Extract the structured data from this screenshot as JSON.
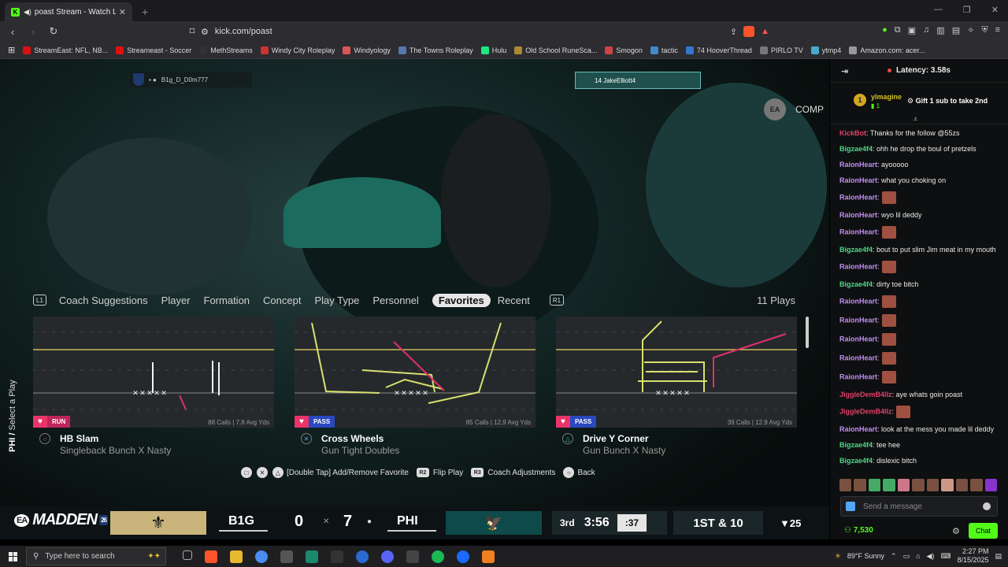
{
  "browser": {
    "tab_title": "poast Stream - Watch Live on",
    "url": "kick.com/poast",
    "bookmarks": [
      {
        "label": "StreamEast: NFL, NB...",
        "color": "#d11"
      },
      {
        "label": "Streameast - Soccer",
        "color": "#d11"
      },
      {
        "label": "MethStreams",
        "color": "#333"
      },
      {
        "label": "Windy City Roleplay",
        "color": "#c33"
      },
      {
        "label": "Windyology",
        "color": "#d55"
      },
      {
        "label": "The Towns Roleplay",
        "color": "#57a"
      },
      {
        "label": "Hulu",
        "color": "#1ce783"
      },
      {
        "label": "Old School RuneSca...",
        "color": "#a83"
      },
      {
        "label": "Smogon",
        "color": "#c44"
      },
      {
        "label": "tactic",
        "color": "#48c"
      },
      {
        "label": "74 HooverThread",
        "color": "#37c"
      },
      {
        "label": "PIRLO TV",
        "color": "#777"
      },
      {
        "label": "ytmp4",
        "color": "#4ac"
      },
      {
        "label": "Amazon.com: acer...",
        "color": "#999"
      }
    ]
  },
  "game": {
    "gamertag": "B1g_D_D0m777",
    "comp_label": "COMP",
    "ea_label": "EA",
    "overlay_tag": "14 JakeElliott4",
    "side_label_team": "PHI /",
    "side_label_rest": "Select a Play",
    "filters": {
      "l1": "L1",
      "r1": "R1",
      "tabs": [
        "Coach Suggestions",
        "Player",
        "Formation",
        "Concept",
        "Play Type",
        "Personnel",
        "Favorites",
        "Recent"
      ],
      "active": "Favorites",
      "count": "11 Plays"
    },
    "plays": [
      {
        "type": "RUN",
        "calls": "88 Calls | 7.8 Avg Yds",
        "name": "HB Slam",
        "formation": "Singleback Bunch X Nasty",
        "button": "○"
      },
      {
        "type": "PASS",
        "calls": "85 Calls | 12.9 Avg Yds",
        "name": "Cross Wheels",
        "formation": "Gun Tight Doubles",
        "button": "✕"
      },
      {
        "type": "PASS",
        "calls": "39 Calls | 12.9 Avg Yds",
        "name": "Drive Y Corner",
        "formation": "Gun Bunch X Nasty",
        "button": "△"
      }
    ],
    "actions": {
      "favorite": "[Double Tap] Add/Remove Favorite",
      "r2": "R2",
      "flip": "Flip Play",
      "r3": "R3",
      "adjust": "Coach Adjustments",
      "back": "Back"
    },
    "scorebug": {
      "logo": "MADDEN",
      "logo_num": "26",
      "away_team": "B1G",
      "away_score": "0",
      "home_score": "7",
      "home_team": "PHI",
      "quarter": "3rd",
      "clock": "3:56",
      "play_clock": ":37",
      "down": "1ST & 10",
      "to_go": "▼25"
    }
  },
  "chat": {
    "latency": "Latency: 3.58s",
    "pinned": {
      "rank": "1",
      "user": "ylmagine",
      "count": "1",
      "gift": "Gift 1 sub to take 2nd"
    },
    "messages": [
      {
        "user": "KickBot",
        "color": "#e0406a",
        "text": ": Thanks for the follow @55zs",
        "emote": false
      },
      {
        "user": "Bigzae4f4",
        "color": "#4fd88a",
        "text": ": ohh he drop the boul of pretzels",
        "emote": false
      },
      {
        "user": "RaionHeart",
        "color": "#c090f0",
        "text": ": ayooooo",
        "emote": false
      },
      {
        "user": "RaionHeart",
        "color": "#c090f0",
        "text": ": what you choking on",
        "emote": false
      },
      {
        "user": "RaionHeart",
        "color": "#c090f0",
        "text": ":",
        "emote": true
      },
      {
        "user": "RaionHeart",
        "color": "#c090f0",
        "text": ": wyo lil deddy",
        "emote": false
      },
      {
        "user": "RaionHeart",
        "color": "#c090f0",
        "text": ":",
        "emote": true
      },
      {
        "user": "Bigzae4f4",
        "color": "#4fd88a",
        "text": ": bout to put slim Jim meat in my mouth",
        "emote": false
      },
      {
        "user": "RaionHeart",
        "color": "#c090f0",
        "text": ":",
        "emote": true
      },
      {
        "user": "Bigzae4f4",
        "color": "#4fd88a",
        "text": ": dirty toe bitch",
        "emote": false
      },
      {
        "user": "RaionHeart",
        "color": "#c090f0",
        "text": ":",
        "emote": true
      },
      {
        "user": "RaionHeart",
        "color": "#c090f0",
        "text": ":",
        "emote": true
      },
      {
        "user": "RaionHeart",
        "color": "#c090f0",
        "text": ":",
        "emote": true
      },
      {
        "user": "RaionHeart",
        "color": "#c090f0",
        "text": ":",
        "emote": true
      },
      {
        "user": "RaionHeart",
        "color": "#c090f0",
        "text": ":",
        "emote": true
      },
      {
        "user": "JiggleDemB4llz",
        "color": "#e0406a",
        "text": ": aye whats goin poast",
        "emote": false
      },
      {
        "user": "JiggleDemB4llz",
        "color": "#e0406a",
        "text": ":",
        "emote": true
      },
      {
        "user": "RaionHeart",
        "color": "#c090f0",
        "text": ": look at the mess you made lil deddy",
        "emote": false
      },
      {
        "user": "Bigzae4f4",
        "color": "#4fd88a",
        "text": ": tee hee",
        "emote": false
      },
      {
        "user": "Bigzae4f4",
        "color": "#4fd88a",
        "text": ": dislexic bitch",
        "emote": false
      }
    ],
    "placeholder": "Send a message",
    "points": "7,530",
    "chat_button": "Chat"
  },
  "taskbar": {
    "search": "Type here to search",
    "weather": "89°F  Sunny",
    "time": "2:27 PM",
    "date": "8/15/2025"
  }
}
